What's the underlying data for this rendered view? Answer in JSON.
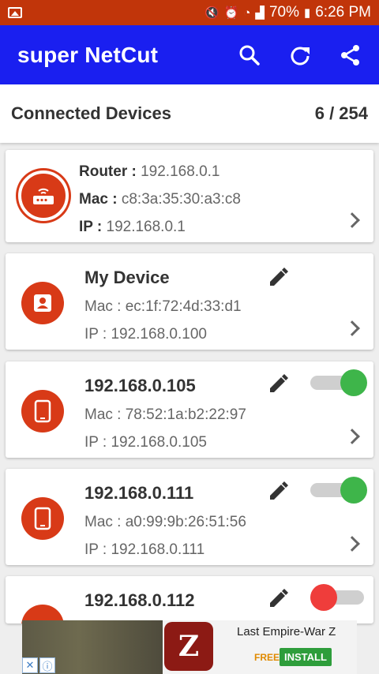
{
  "statusbar": {
    "battery": "70%",
    "time": "6:26 PM"
  },
  "appbar": {
    "title": "super NetCut"
  },
  "connected": {
    "label": "Connected Devices",
    "count": "6 / 254"
  },
  "router": {
    "label": "Router :",
    "value": "192.168.0.1",
    "mac_label": "Mac :",
    "mac": "c8:3a:35:30:a3:c8",
    "ip_label": "IP :",
    "ip": "192.168.0.1"
  },
  "devices": [
    {
      "name": "My Device",
      "mac_label": "Mac :",
      "mac": "ec:1f:72:4d:33:d1",
      "ip_label": "IP :",
      "ip": "192.168.0.100",
      "toggle": null
    },
    {
      "name": "192.168.0.105",
      "mac_label": "Mac :",
      "mac": "78:52:1a:b2:22:97",
      "ip_label": "IP :",
      "ip": "192.168.0.105",
      "toggle": "on"
    },
    {
      "name": "192.168.0.111",
      "mac_label": "Mac :",
      "mac": "a0:99:9b:26:51:56",
      "ip_label": "IP :",
      "ip": "192.168.0.111",
      "toggle": "on"
    },
    {
      "name": "192.168.0.112",
      "toggle": "off"
    }
  ],
  "ad": {
    "title": "Last Empire-War Z",
    "free": "FREE",
    "install": "INSTALL",
    "logo_letter": "Z"
  },
  "colors": {
    "appbar": "#1a1ff0",
    "statusbar": "#c1350a",
    "avatar": "#d83a17",
    "on": "#3eb54a",
    "off": "#ef3d3b"
  }
}
